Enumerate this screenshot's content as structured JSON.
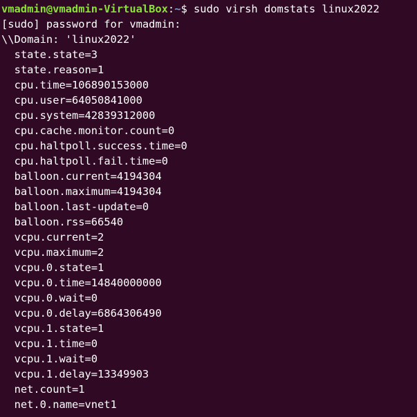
{
  "prompt": {
    "user_host": "vmadmin@vmadmin-VirtualBox",
    "separator": ":",
    "path": "~",
    "symbol": "$ ",
    "command": "sudo virsh domstats linux2022"
  },
  "output": {
    "sudo_prompt": "[sudo] password for vmadmin:",
    "domain_line": "\\\\Domain: 'linux2022'",
    "stats": [
      "state.state=3",
      "state.reason=1",
      "cpu.time=106890153000",
      "cpu.user=64050841000",
      "cpu.system=42839312000",
      "cpu.cache.monitor.count=0",
      "cpu.haltpoll.success.time=0",
      "cpu.haltpoll.fail.time=0",
      "balloon.current=4194304",
      "balloon.maximum=4194304",
      "balloon.last-update=0",
      "balloon.rss=66540",
      "vcpu.current=2",
      "vcpu.maximum=2",
      "vcpu.0.state=1",
      "vcpu.0.time=14840000000",
      "vcpu.0.wait=0",
      "vcpu.0.delay=6864306490",
      "vcpu.1.state=1",
      "vcpu.1.time=0",
      "vcpu.1.wait=0",
      "vcpu.1.delay=13349903",
      "net.count=1",
      "net.0.name=vnet1"
    ]
  },
  "colors": {
    "background": "#300a24",
    "user_host": "#8ae234",
    "path": "#729fcf",
    "text": "#ffffff"
  }
}
